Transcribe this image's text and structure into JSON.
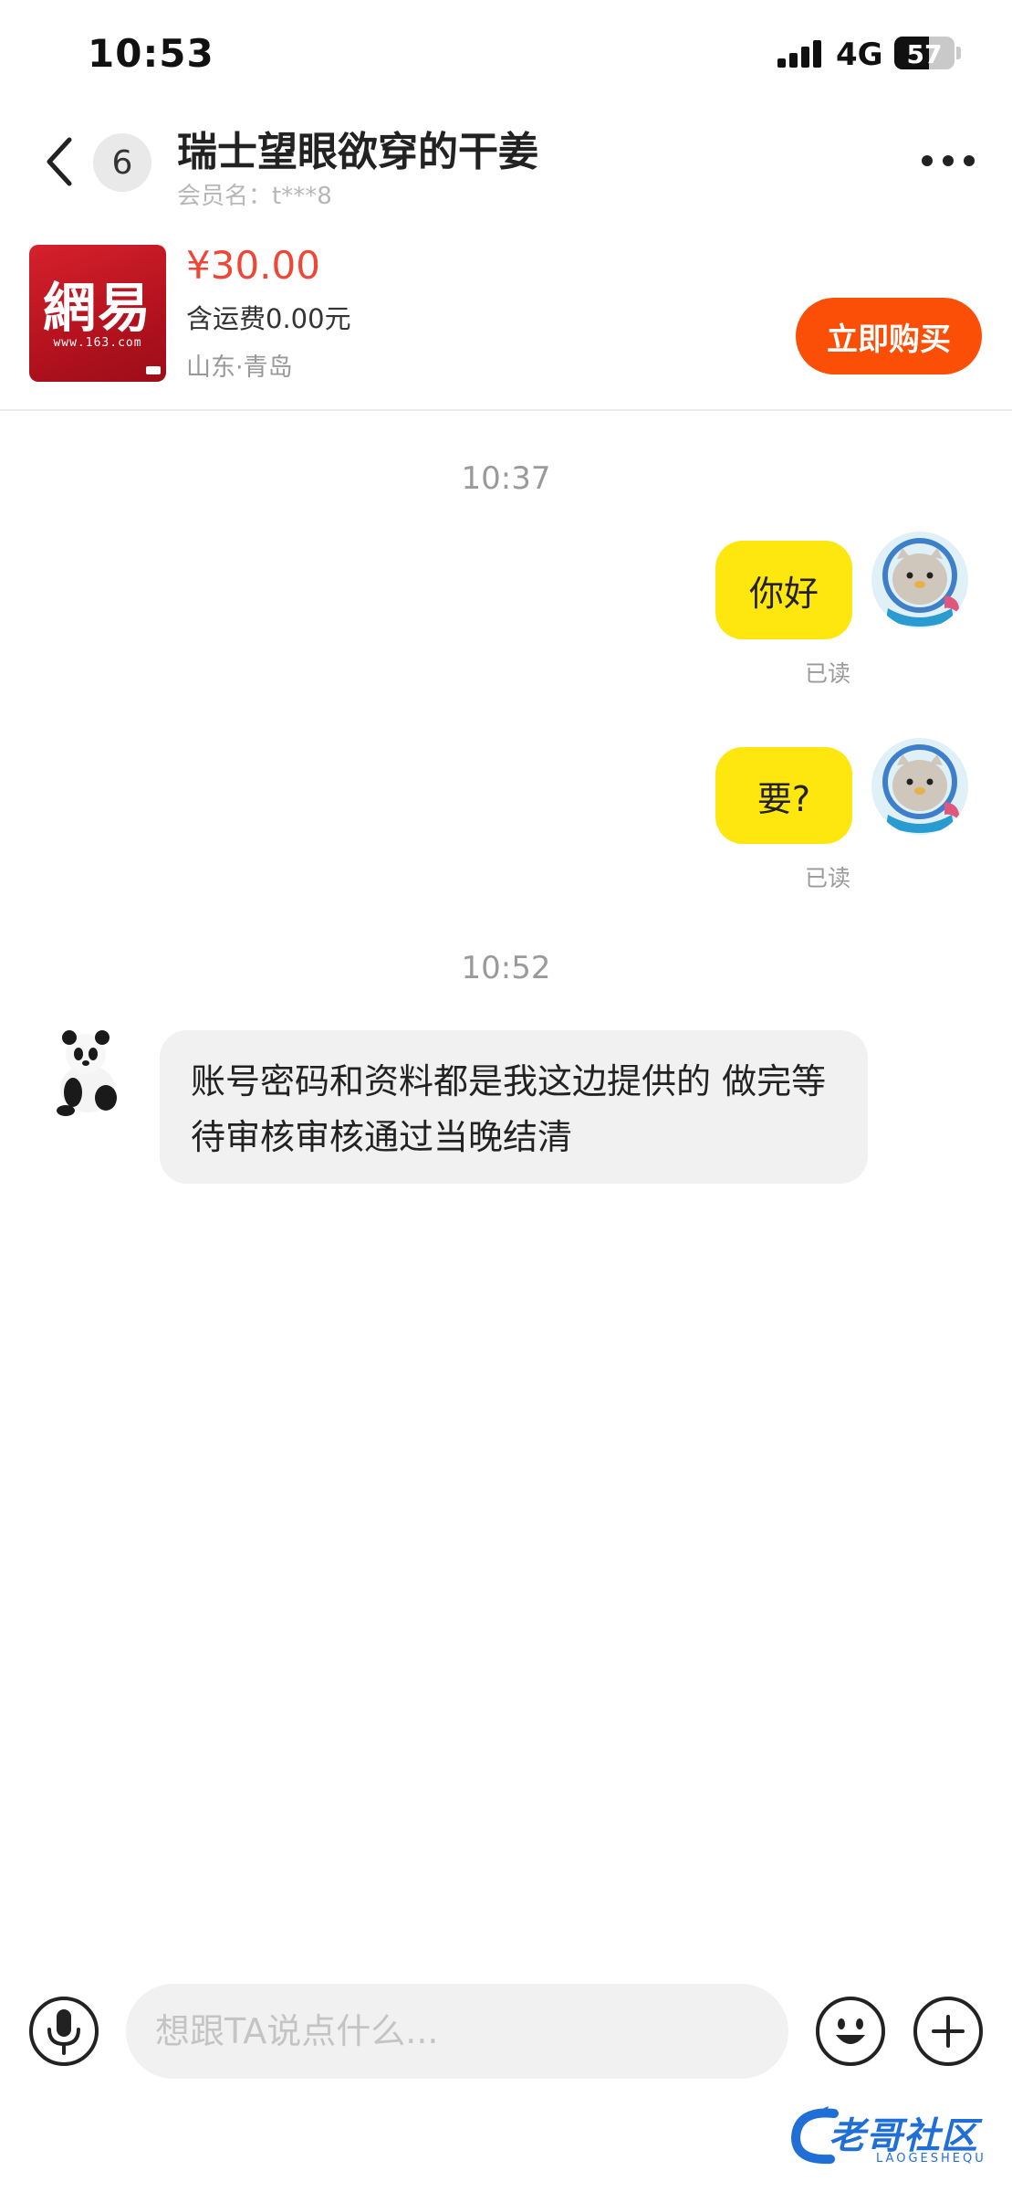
{
  "status_bar": {
    "time": "10:53",
    "network": "4G",
    "battery": "57",
    "battery_level_percent": 57
  },
  "header": {
    "unread_count": "6",
    "title": "瑞士望眼欲穿的干姜",
    "member_name": "会员名：t***8"
  },
  "product": {
    "thumbnail_logo": "網易",
    "thumbnail_url": "www.163.com",
    "price": "¥30.00",
    "shipping": "含运费0.00元",
    "location": "山东·青岛",
    "buy_label": "立即购买"
  },
  "messages": {
    "time_1": "10:37",
    "msg_1": "你好",
    "read_1": "已读",
    "msg_2": "要?",
    "read_2": "已读",
    "time_2": "10:52",
    "msg_3": "账号密码和资料都是我这边提供的 做完等待审核审核通过当晚结清"
  },
  "input": {
    "placeholder": "想跟TA说点什么..."
  },
  "icons": {
    "back": "chevron-left-icon",
    "more": "more-dots-icon",
    "voice": "microphone-icon",
    "emoji": "smiley-icon",
    "plus": "plus-icon"
  },
  "watermark": {
    "text": "老哥社区",
    "sub": "LAOGESHEQU"
  },
  "colors": {
    "accent_orange": "#fb4f07",
    "price_red": "#f04637",
    "bubble_yellow": "#fee60f",
    "bubble_gray": "#f1f1f2"
  }
}
